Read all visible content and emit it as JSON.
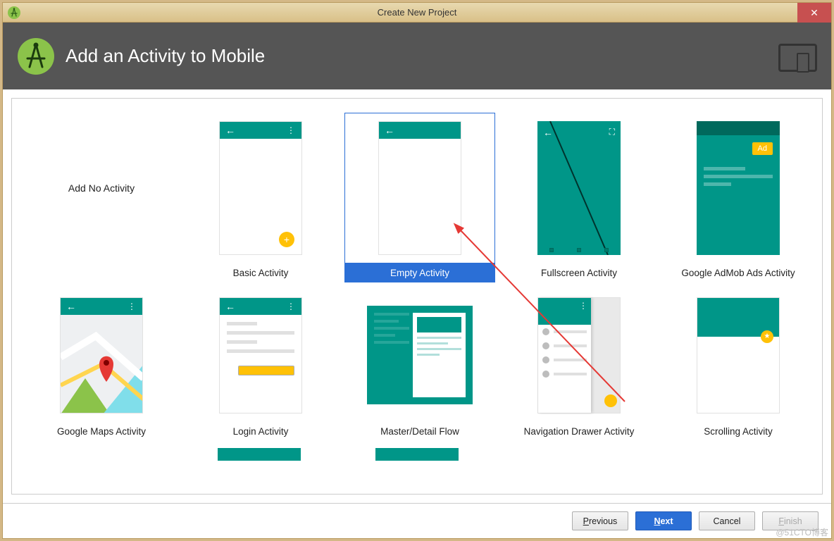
{
  "titlebar": {
    "title": "Create New Project",
    "close": "✕"
  },
  "header": {
    "title": "Add an Activity to Mobile"
  },
  "templates": [
    {
      "label": "Add No Activity",
      "kind": "none"
    },
    {
      "label": "Basic Activity",
      "kind": "basic"
    },
    {
      "label": "Empty Activity",
      "kind": "empty",
      "selected": true
    },
    {
      "label": "Fullscreen Activity",
      "kind": "fullscreen"
    },
    {
      "label": "Google AdMob Ads Activity",
      "kind": "admob"
    },
    {
      "label": "Google Maps Activity",
      "kind": "maps"
    },
    {
      "label": "Login Activity",
      "kind": "login"
    },
    {
      "label": "Master/Detail Flow",
      "kind": "master"
    },
    {
      "label": "Navigation Drawer Activity",
      "kind": "navdrawer"
    },
    {
      "label": "Scrolling Activity",
      "kind": "scroll"
    }
  ],
  "admob_badge": "Ad",
  "footer": {
    "previous": "Previous",
    "next": "Next",
    "cancel": "Cancel",
    "finish": "Finish"
  },
  "watermark": "@51CTO博客"
}
